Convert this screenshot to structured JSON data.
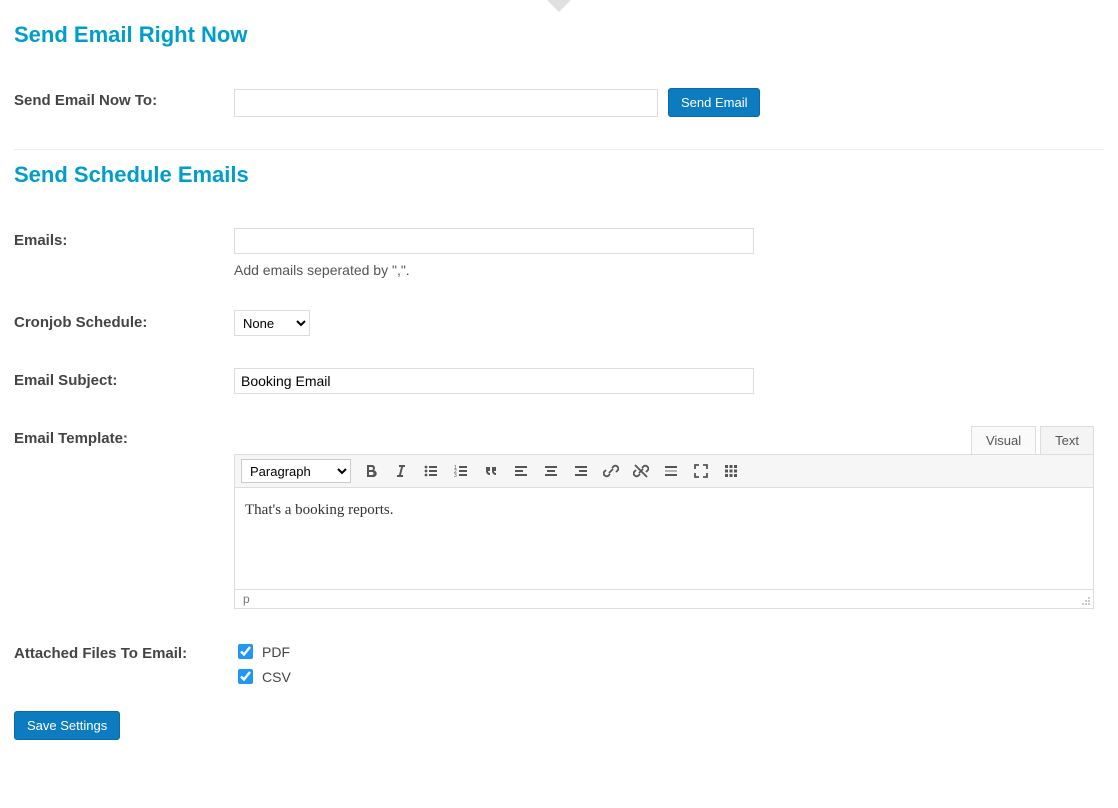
{
  "section1_title": "Send Email Right Now",
  "send_now": {
    "label": "Send Email Now To:",
    "value": "",
    "button": "Send Email"
  },
  "section2_title": "Send Schedule Emails",
  "emails": {
    "label": "Emails:",
    "value": "",
    "helper": "Add emails seperated by \",\"."
  },
  "cronjob": {
    "label": "Cronjob Schedule:",
    "selected": "None"
  },
  "subject": {
    "label": "Email Subject:",
    "value": "Booking Email"
  },
  "template": {
    "label": "Email Template:",
    "tabs": {
      "visual": "Visual",
      "text": "Text"
    },
    "paragraph_select": "Paragraph",
    "content": "That's a booking reports.",
    "status_path": "p"
  },
  "attached": {
    "label": "Attached Files To Email:",
    "pdf_label": "PDF",
    "csv_label": "CSV",
    "pdf_checked": true,
    "csv_checked": true
  },
  "save_button": "Save Settings"
}
